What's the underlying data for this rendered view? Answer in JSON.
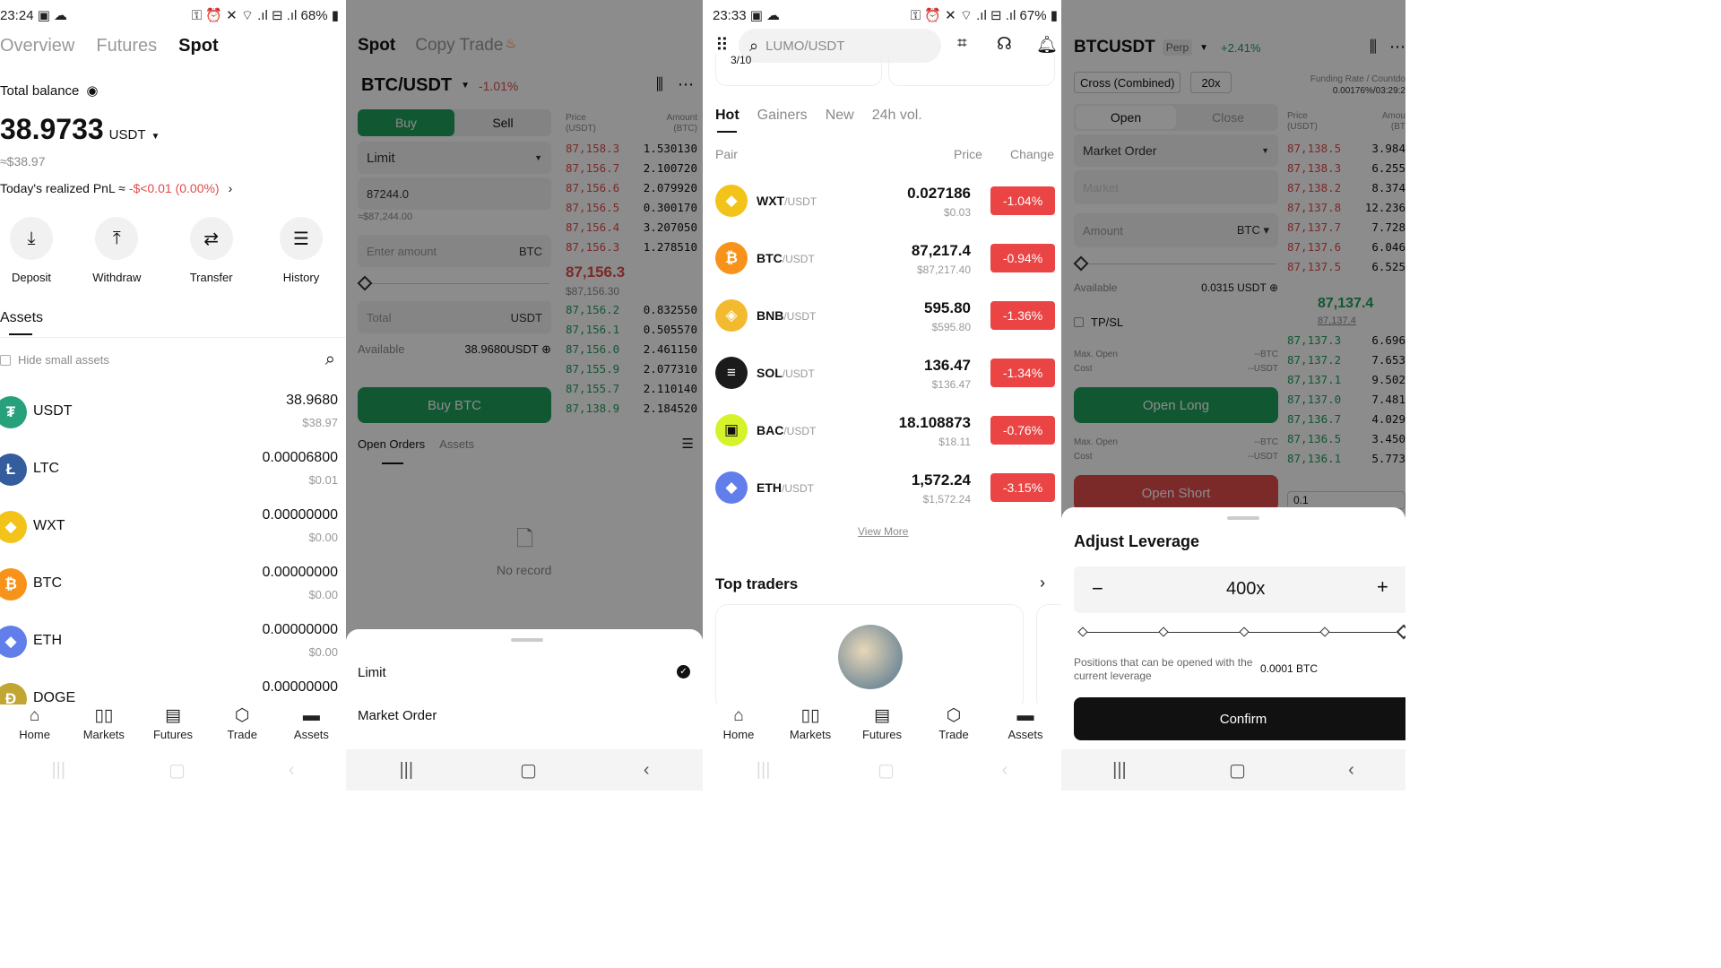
{
  "p1": {
    "status": {
      "time": "23:24",
      "battery": "68%"
    },
    "tabs": [
      "Overview",
      "Futures",
      "Spot"
    ],
    "total_balance_label": "Total balance",
    "balance_value": "38.9733",
    "balance_unit": "USDT",
    "balance_approx": "≈$38.97",
    "pnl_label": "Today's realized PnL ≈",
    "pnl_value": "-$<0.01 (0.00%)",
    "actions": [
      "Deposit",
      "Withdraw",
      "Transfer",
      "History"
    ],
    "assets_title": "Assets",
    "hide_small": "Hide small assets",
    "assets": [
      {
        "name": "USDT",
        "amount": "38.9680",
        "usd": "$38.97",
        "color": "#26a17b",
        "glyph": "₮"
      },
      {
        "name": "LTC",
        "amount": "0.00006800",
        "usd": "$0.01",
        "color": "#345d9d",
        "glyph": "Ł"
      },
      {
        "name": "WXT",
        "amount": "0.00000000",
        "usd": "$0.00",
        "color": "#f3c31a",
        "glyph": "◆"
      },
      {
        "name": "BTC",
        "amount": "0.00000000",
        "usd": "$0.00",
        "color": "#f7931a",
        "glyph": "₿"
      },
      {
        "name": "ETH",
        "amount": "0.00000000",
        "usd": "$0.00",
        "color": "#627eea",
        "glyph": "◆"
      },
      {
        "name": "DOGE",
        "amount": "0.00000000",
        "usd": "",
        "color": "#c2a633",
        "glyph": "Ð"
      }
    ]
  },
  "nav": [
    "Home",
    "Markets",
    "Futures",
    "Trade",
    "Assets"
  ],
  "p2": {
    "tabs": [
      "Spot",
      "Copy Trade"
    ],
    "pair": "BTC/USDT",
    "pair_change": "-1.01%",
    "buy": "Buy",
    "sell": "Sell",
    "order_type": "Limit",
    "price_value": "87244.0",
    "price_usd": "≈$87,244.00",
    "amount_placeholder": "Enter amount",
    "amount_unit": "BTC",
    "total_label": "Total",
    "total_unit": "USDT",
    "available_label": "Available",
    "available_value": "38.9680USDT",
    "buy_btn": "Buy BTC",
    "ob_head_price": "Price\n(USDT)",
    "ob_head_amount": "Amount\n(BTC)",
    "asks": [
      [
        "87,158.3",
        "1.530130"
      ],
      [
        "87,156.7",
        "2.100720"
      ],
      [
        "87,156.6",
        "2.079920"
      ],
      [
        "87,156.5",
        "0.300170"
      ],
      [
        "87,156.4",
        "3.207050"
      ],
      [
        "87,156.3",
        "1.278510"
      ]
    ],
    "mid_price": "87,156.3",
    "mid_usd": "$87,156.30",
    "bids": [
      [
        "87,156.2",
        "0.832550"
      ],
      [
        "87,156.1",
        "0.505570"
      ],
      [
        "87,156.0",
        "2.461150"
      ],
      [
        "87,155.9",
        "2.077310"
      ],
      [
        "87,155.7",
        "2.110140"
      ],
      [
        "87,138.9",
        "2.184520"
      ]
    ],
    "bottom_tabs": [
      "Open Orders",
      "Assets"
    ],
    "no_record": "No record",
    "sheet": [
      "Limit",
      "Market Order"
    ]
  },
  "p3": {
    "status": {
      "time": "23:33",
      "battery": "67%"
    },
    "search_placeholder": "LUMO/USDT",
    "banner_snippet": "3/10",
    "tabs": [
      "Hot",
      "Gainers",
      "New",
      "24h vol."
    ],
    "head": [
      "Pair",
      "Price",
      "Change"
    ],
    "pairs": [
      {
        "base": "WXT",
        "quote": "/USDT",
        "price": "0.027186",
        "usd": "$0.03",
        "chg": "-1.04%",
        "color": "#f3c31a",
        "glyph": "◆"
      },
      {
        "base": "BTC",
        "quote": "/USDT",
        "price": "87,217.4",
        "usd": "$87,217.40",
        "chg": "-0.94%",
        "color": "#f7931a",
        "glyph": "₿"
      },
      {
        "base": "BNB",
        "quote": "/USDT",
        "price": "595.80",
        "usd": "$595.80",
        "chg": "-1.36%",
        "color": "#f3ba2f",
        "glyph": "◈"
      },
      {
        "base": "SOL",
        "quote": "/USDT",
        "price": "136.47",
        "usd": "$136.47",
        "chg": "-1.34%",
        "color": "#1b1b1b",
        "glyph": "≡"
      },
      {
        "base": "BAC",
        "quote": "/USDT",
        "price": "18.108873",
        "usd": "$18.11",
        "chg": "-0.76%",
        "color": "#d6f22a",
        "glyph": "▣"
      },
      {
        "base": "ETH",
        "quote": "/USDT",
        "price": "1,572.24",
        "usd": "$1,572.24",
        "chg": "-3.15%",
        "color": "#627eea",
        "glyph": "◆"
      }
    ],
    "view_more": "View More",
    "top_traders": "Top traders"
  },
  "p4": {
    "pair": "BTCUSDT",
    "perp": "Perp",
    "change": "+2.41%",
    "margin_mode": "Cross (Combined)",
    "leverage_chip": "20x",
    "funding_label": "Funding Rate / Countdo",
    "funding_value": "0.00176%/03:29:2",
    "open": "Open",
    "close": "Close",
    "order_type": "Market Order",
    "market_ph": "Market",
    "amount_ph": "Amount",
    "amount_unit": "BTC",
    "available_label": "Available",
    "available_value": "0.0315 USDT",
    "tpsl": "TP/SL",
    "maxopen_label": "Max. Open",
    "cost_label": "Cost",
    "btc_dash": "--BTC",
    "usdt_dash": "--USDT",
    "open_long": "Open Long",
    "open_short": "Open Short",
    "ob_head_price": "Price\n(USDT)",
    "ob_head_amount": "Amou\n(BT",
    "asks": [
      [
        "87,138.5",
        "3.984"
      ],
      [
        "87,138.3",
        "6.255"
      ],
      [
        "87,138.2",
        "8.374"
      ],
      [
        "87,137.8",
        "12.236"
      ],
      [
        "87,137.7",
        "7.728"
      ],
      [
        "87,137.6",
        "6.046"
      ],
      [
        "87,137.5",
        "6.525"
      ]
    ],
    "mid_price": "87,137.4",
    "mid_sub": "87,137.4",
    "bids": [
      [
        "87,137.3",
        "6.696"
      ],
      [
        "87,137.2",
        "7.653"
      ],
      [
        "87,137.1",
        "9.502"
      ],
      [
        "87,137.0",
        "7.481"
      ],
      [
        "87,136.7",
        "4.029"
      ],
      [
        "87,136.5",
        "3.450"
      ],
      [
        "87,136.1",
        "5.773"
      ]
    ],
    "depth_value": "0.1",
    "sheet_title": "Adjust Leverage",
    "leverage": "400x",
    "minus": "−",
    "plus": "+",
    "positions_text": "Positions that can be opened with the current leverage",
    "positions_value": "0.0001 BTC",
    "confirm": "Confirm"
  }
}
